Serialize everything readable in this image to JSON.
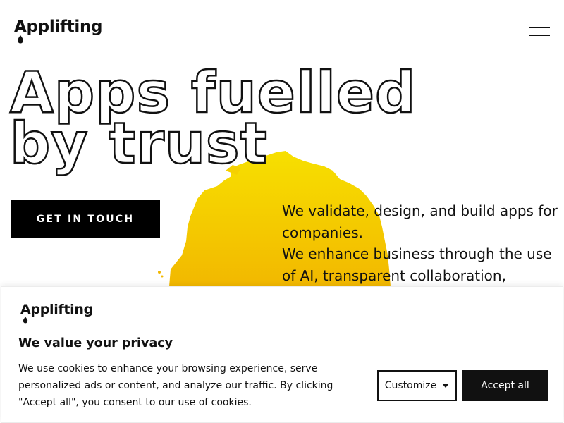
{
  "header": {
    "logo_text": "Applifting",
    "menu_icon": "hamburger-menu-icon"
  },
  "hero": {
    "title_line1": "Apps fuelled",
    "title_line2": "by trust",
    "cta_label": "GET IN TOUCH",
    "tagline_line1": "We validate, design, and build apps for companies.",
    "tagline_line2": "We enhance business through the use of AI, transparent collaboration,",
    "accent_color": "#F5C800"
  },
  "cookie_banner": {
    "logo_text": "Applifting",
    "title": "We value your privacy",
    "text": "We use cookies to enhance your browsing experience, serve personalized ads or content, and analyze our traffic. By clicking \"Accept all\", you consent to our use of cookies.",
    "customize_label": "Customize",
    "accept_label": "Accept all",
    "caret_icon": "caret-down-icon"
  }
}
